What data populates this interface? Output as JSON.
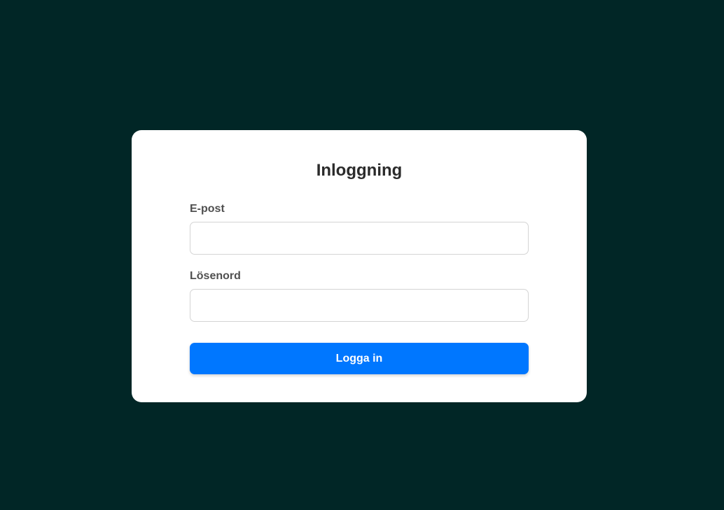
{
  "login_form": {
    "title": "Inloggning",
    "email": {
      "label": "E-post",
      "value": ""
    },
    "password": {
      "label": "Lösenord",
      "value": ""
    },
    "submit_label": "Logga in"
  },
  "colors": {
    "background": "#012626",
    "card": "#ffffff",
    "primary_button": "#0077ff",
    "title_text": "#2b2b2b",
    "label_text": "#505050",
    "input_border": "#d4d4d4"
  }
}
